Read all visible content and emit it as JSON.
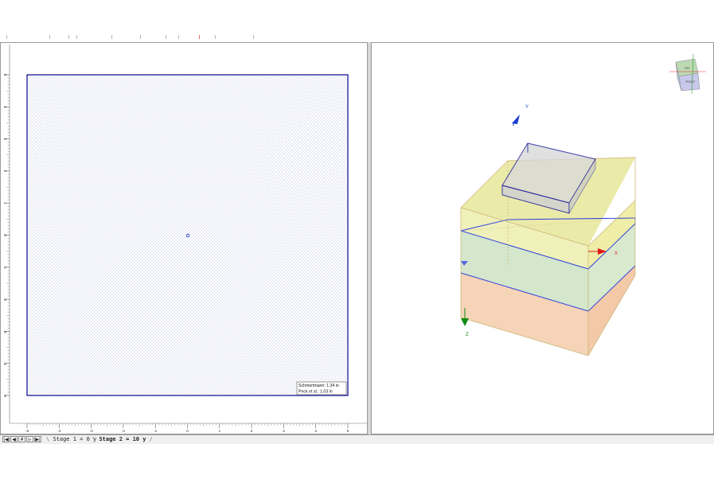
{
  "plan_view": {
    "x_ticks": [
      "-5",
      "-4",
      "-3",
      "-2",
      "-1",
      "0",
      "1",
      "2",
      "3",
      "4",
      "5"
    ],
    "y_ticks": [
      "5",
      "4",
      "3",
      "2",
      "1",
      "0",
      "-1",
      "-2",
      "-3",
      "-4",
      "-5"
    ],
    "results": {
      "line1": "Schmertmann: 1.34 in",
      "line2": "Peck et al.: 1.03 in"
    },
    "colors": {
      "border": "#1a1a9c",
      "hatch": "#cfd3ef"
    }
  },
  "view3d": {
    "axes": {
      "y": "Y",
      "x": "X",
      "z": "Z"
    },
    "nav_cube": {
      "top": "TOP",
      "front": "FRONT"
    },
    "colors": {
      "layer_top": "#e7e79a",
      "layer_mid": "#cfe4c8",
      "layer_bottom": "#f4cfb0",
      "footing": "#d9d9d9",
      "axis_y": "#1a3ccf",
      "axis_x": "#e01818",
      "axis_z": "#138a13"
    }
  },
  "tabs": {
    "nav": [
      "|◀",
      "◀",
      "▶",
      "▶|"
    ],
    "stage1": "Stage 1 = 0 y",
    "stage2": "Stage 2 = 10 y"
  }
}
